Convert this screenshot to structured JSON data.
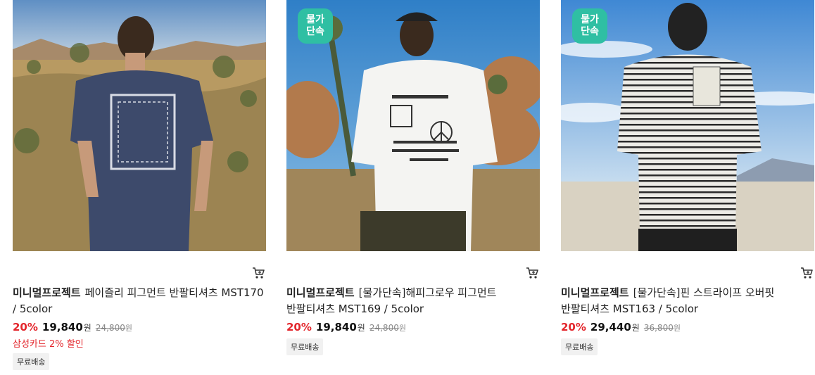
{
  "products": [
    {
      "badge": "",
      "brand": "미니멀프로젝트",
      "name": "페이즐리 피그먼트 반팔티셔츠 MST170 / 5color",
      "discount": "20%",
      "price": "19,840",
      "price_unit": "원",
      "original_price": "24,800",
      "original_unit": "원",
      "card_discount": "삼성카드 2% 할인",
      "tag": "무료배송",
      "shirt_color": "#3d4a6b",
      "cart_icon": "cart-icon"
    },
    {
      "badge": "물가\n단속",
      "brand": "미니멀프로젝트",
      "name": "[물가단속]해피그로우 피그먼트 반팔티셔츠 MST169 / 5color",
      "discount": "20%",
      "price": "19,840",
      "price_unit": "원",
      "original_price": "24,800",
      "original_unit": "원",
      "card_discount": "",
      "tag": "무료배송",
      "shirt_color": "#f4f4f2",
      "cart_icon": "cart-icon"
    },
    {
      "badge": "물가\n단속",
      "brand": "미니멀프로젝트",
      "name": "[물가단속]핀 스트라이프 오버핏 반팔티셔츠 MST163 / 5color",
      "discount": "20%",
      "price": "29,440",
      "price_unit": "원",
      "original_price": "36,800",
      "original_unit": "원",
      "card_discount": "",
      "tag": "무료배송",
      "shirt_color": "#ecebe6",
      "cart_icon": "cart-icon"
    }
  ],
  "colors": {
    "badge": "#2fbfa3",
    "discount": "#e3262c",
    "tag_bg": "#f1f1f1"
  }
}
